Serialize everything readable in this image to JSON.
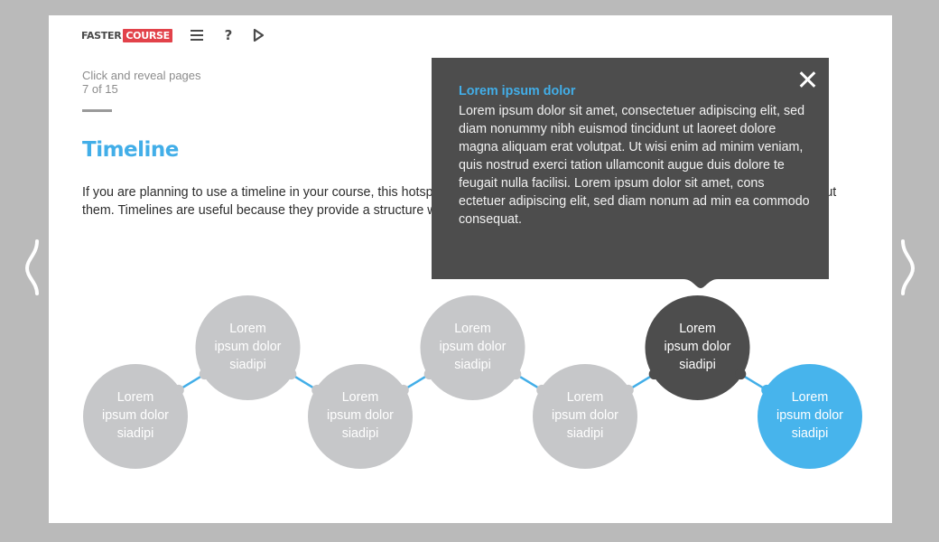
{
  "header": {
    "logo_left": "FASTER",
    "logo_right": "COURSE",
    "icons": [
      "menu-icon",
      "help-icon",
      "play-icon"
    ],
    "help_label": "?"
  },
  "page": {
    "subtitle": "Click and reveal pages",
    "progress": "7 of 15",
    "title": "Timeline",
    "intro": "If you are planning to use a timeline in your course, this hotspot will be very useful; you just need to add dates and information about them. Timelines are useful because they provide a structure which you can use for displaying information."
  },
  "timeline": {
    "active_index": 5,
    "visited_index": 6,
    "nodes": [
      {
        "label": "Lorem ipsum dolor siadipi",
        "state": "default"
      },
      {
        "label": "Lorem ipsum dolor siadipi",
        "state": "default"
      },
      {
        "label": "Lorem ipsum dolor siadipi",
        "state": "default"
      },
      {
        "label": "Lorem ipsum dolor siadipi",
        "state": "default"
      },
      {
        "label": "Lorem ipsum dolor siadipi",
        "state": "default"
      },
      {
        "label": "Lorem ipsum dolor siadipi",
        "state": "active"
      },
      {
        "label": "Lorem ipsum dolor siadipi",
        "state": "highlight"
      }
    ]
  },
  "popup": {
    "title": "Lorem ipsum dolor",
    "body": "Lorem ipsum dolor sit amet, consectetuer adipiscing elit, sed diam nonummy nibh euismod tincidunt ut laoreet dolore magna aliquam erat volutpat. Ut wisi enim ad minim veniam, quis nostrud exerci tation ullamconit augue duis dolore te feugait nulla facilisi. Lorem ipsum dolor sit amet, cons ectetuer adipiscing elit, sed diam nonum ad min ea commodo consequat.",
    "close_icon": "close-icon"
  },
  "navigation": {
    "prev_icon": "chevron-left-icon",
    "next_icon": "chevron-right-icon"
  },
  "colors": {
    "accent": "#42aee8",
    "brand_red": "#e2424a",
    "node_default": "#c6c7c9",
    "node_active": "#4d4d4d",
    "node_highlight": "#47b4ec",
    "popup_bg": "#4d4d4d",
    "backdrop": "#bababa"
  }
}
